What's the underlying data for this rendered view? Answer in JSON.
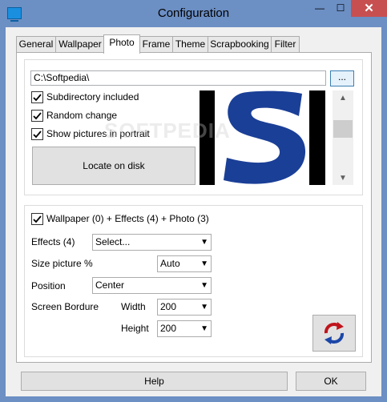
{
  "window": {
    "title": "Configuration"
  },
  "tabs": [
    "General",
    "Wallpaper",
    "Photo",
    "Frame",
    "Theme",
    "Scrapbooking",
    "Filter"
  ],
  "active_tab": "Photo",
  "photo": {
    "path": "C:\\Softpedia\\",
    "browse_label": "...",
    "subdirectory_label": "Subdirectory included",
    "random_label": "Random change",
    "portrait_label": "Show pictures in portrait",
    "locate_label": "Locate on disk"
  },
  "options": {
    "wallpaper_label": "Wallpaper (0) + Effects (4) + Photo (3)",
    "effects_label": "Effects (4)",
    "effects_value": "Select...",
    "size_label": "Size picture %",
    "size_value": "Auto",
    "position_label": "Position",
    "position_value": "Center",
    "border_label": "Screen Bordure",
    "width_label": "Width",
    "width_value": "200",
    "height_label": "Height",
    "height_value": "200"
  },
  "buttons": {
    "help": "Help",
    "ok": "OK"
  },
  "watermark": "SOFTPEDIA",
  "colors": {
    "accent": "#1a4fa0",
    "close": "#c74f50"
  }
}
